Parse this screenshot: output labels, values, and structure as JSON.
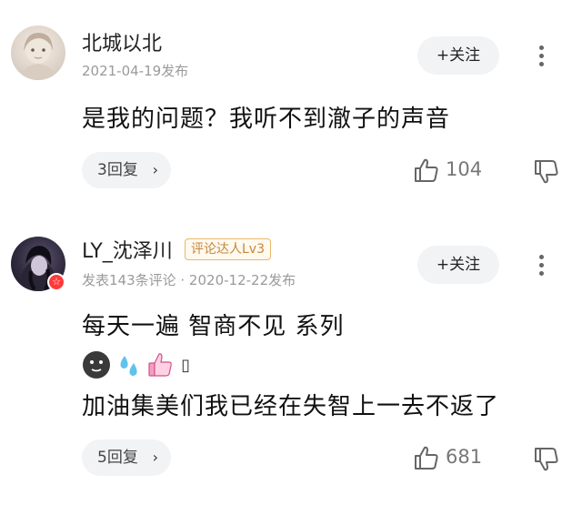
{
  "comments": [
    {
      "username": "北城以北",
      "meta": "2021-04-19发布",
      "follow_label": "+关注",
      "text_lines": [
        "是我的问题？我听不到澈子的声音"
      ],
      "reply_label": "3回复",
      "likes": "104"
    },
    {
      "username": "LY_沈泽川",
      "level_tag": "评论达人Lv3",
      "verified_badge": "☆",
      "meta": "发表143条评论 · 2020-12-22发布",
      "follow_label": "+关注",
      "text_lines": [
        "每天一遍 智商不见 系列",
        "加油集美们我已经在失智上一去不返了"
      ],
      "emojis": [
        "dark-face-emoji",
        "sweat-drops-emoji",
        "thumbs-up-emoji",
        "placeholder-glyph"
      ],
      "emoji_tail": "▯",
      "reply_label": "5回复",
      "likes": "681"
    }
  ],
  "icons": {
    "chevron": "›",
    "more": "more-vertical-icon",
    "like": "thumb-up-outline-icon",
    "dislike": "thumb-down-outline-icon"
  }
}
